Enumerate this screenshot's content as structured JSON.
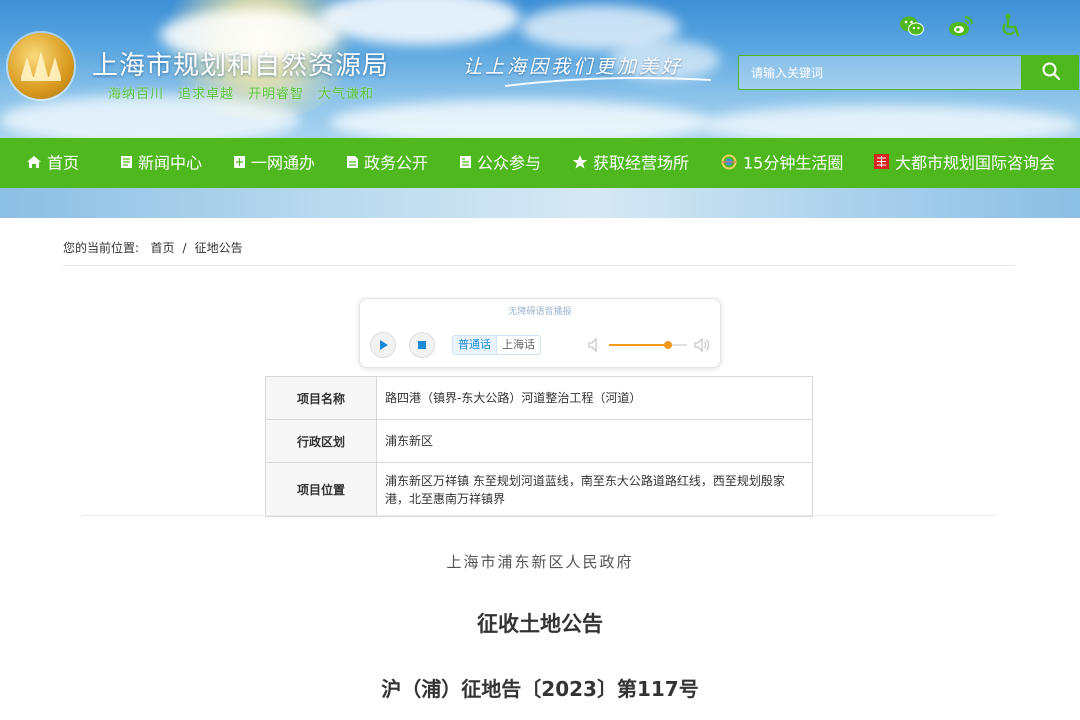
{
  "header": {
    "site_title": "上海市规划和自然资源局",
    "motto": [
      "海纳百川",
      "追求卓越",
      "开明睿智",
      "大气谦和"
    ],
    "slogan": "让上海因我们更加美好",
    "top_icons": [
      "wechat-icon",
      "weibo-icon",
      "accessibility-icon"
    ],
    "search": {
      "placeholder": "请输入关键词"
    },
    "colors": {
      "brand_green": "#4fb81e",
      "sky": "#5aa6e0",
      "logo_gold": "#d99a1e"
    }
  },
  "nav": {
    "items": [
      {
        "label": "首页",
        "icon": "home-icon"
      },
      {
        "label": "新闻中心",
        "icon": "news-icon"
      },
      {
        "label": "一网通办",
        "icon": "service-icon"
      },
      {
        "label": "政务公开",
        "icon": "doc-icon"
      },
      {
        "label": "公众参与",
        "icon": "participate-icon"
      },
      {
        "label": "获取经营场所",
        "icon": "star-icon"
      },
      {
        "label": "15分钟生活圈",
        "icon": "circle-icon"
      },
      {
        "label": "大都市规划国际咨询会",
        "icon": "seal-icon"
      }
    ]
  },
  "breadcrumb": {
    "prefix": "您的当前位置:",
    "items": [
      "首页",
      "征地公告"
    ],
    "separator": "/"
  },
  "player": {
    "title": "无障碍语音播报",
    "languages": [
      "普通话",
      "上海话"
    ],
    "active_language": "普通话",
    "volume": 0.75,
    "colors": {
      "accent": "#1a8ad4",
      "volume": "#f39a1e"
    }
  },
  "info_table": {
    "rows": [
      {
        "key": "项目名称",
        "value": "路四港（镇界-东大公路）河道整治工程（河道）"
      },
      {
        "key": "行政区划",
        "value": "浦东新区"
      },
      {
        "key": "项目位置",
        "value": "浦东新区万祥镇 东至规划河道蓝线，南至东大公路道路红线，西至规划殷家港，北至惠南万祥镇界"
      }
    ]
  },
  "document": {
    "org": "上海市浦东新区人民政府",
    "title": "征收土地公告",
    "number": "沪（浦）征地告〔2023〕第117号"
  }
}
